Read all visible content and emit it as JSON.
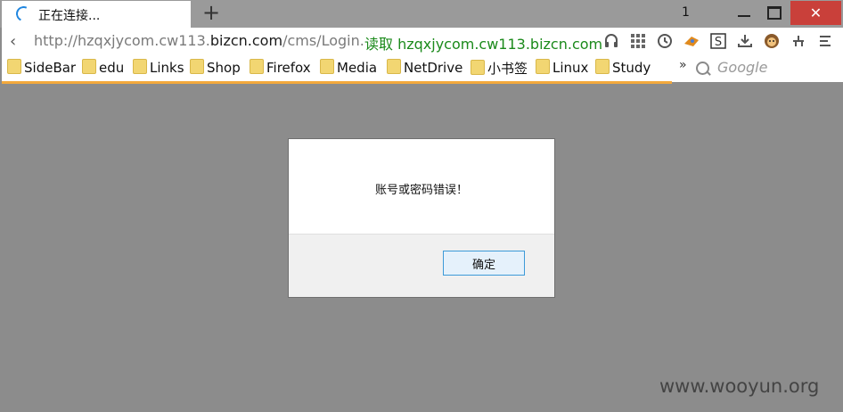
{
  "tab": {
    "title": "正在连接...",
    "new_tab": "+",
    "count": "1"
  },
  "window": {
    "close": "✕"
  },
  "nav": {
    "back": "‹",
    "url_prefix": "http://hzqxjycom.cw113.",
    "url_host": "bizcn.com",
    "url_path": "/cms/Login.",
    "reader": "读取 hzqxjycom.cw113.bizcn.com"
  },
  "toolbar_icons": [
    "headphones-icon",
    "grid-icon",
    "history-icon",
    "paw-icon",
    "s-icon",
    "download-icon",
    "monkey-icon",
    "tool-icon",
    "menu-icon"
  ],
  "bookmarks": {
    "items": [
      "SideBar",
      "edu",
      "Links",
      "Shop",
      "Firefox",
      "Media",
      "NetDrive",
      "小书签",
      "Linux",
      "Study"
    ],
    "overflow": "»",
    "search_placeholder": "Google"
  },
  "dialog": {
    "message": "账号或密码错误！",
    "ok_label": "确定"
  },
  "watermark": "www.wooyun.org",
  "colors": {
    "backdrop": "#8c8c8c",
    "loading": "#f3a93c",
    "reader": "#1b8a1b",
    "close": "#c9403a"
  }
}
